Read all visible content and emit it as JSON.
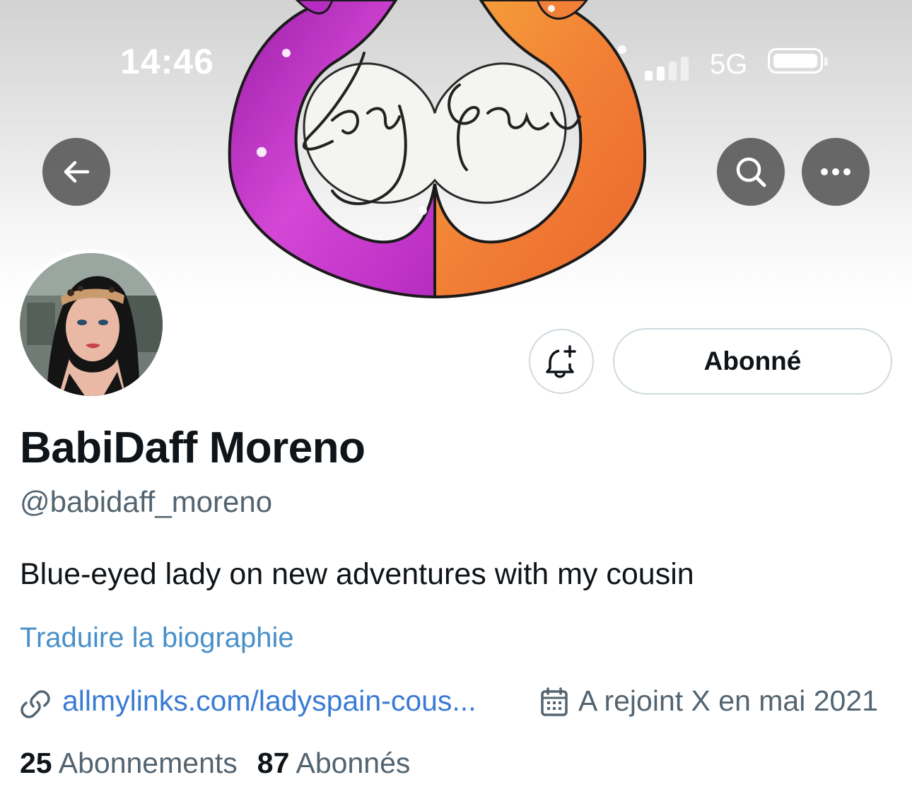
{
  "status_bar": {
    "time": "14:46",
    "network": "5G"
  },
  "banner": {
    "logo_text": "Lady Spain",
    "colors": {
      "left_heart": "#c83ad0",
      "right_heart": "#f07a2e"
    }
  },
  "actions": {
    "back_icon": "arrow-left-icon",
    "search_icon": "search-icon",
    "more_icon": "more-horizontal-icon",
    "notify_icon": "bell-plus-icon",
    "follow_label": "Abonné"
  },
  "profile": {
    "display_name": "BabiDaff Moreno",
    "handle": "@babidaff_moreno",
    "bio": "Blue-eyed lady on new adventures with my cousin",
    "translate_label": "Traduire la biographie",
    "website": "allmylinks.com/ladyspain-cous...",
    "joined": "A rejoint X en mai 2021"
  },
  "stats": {
    "following_count": "25",
    "following_label": "Abonnements",
    "followers_count": "87",
    "followers_label": "Abonnés"
  },
  "colors": {
    "link": "#3a7bd5",
    "secondary_text": "#536471",
    "border": "#cfd9de"
  }
}
